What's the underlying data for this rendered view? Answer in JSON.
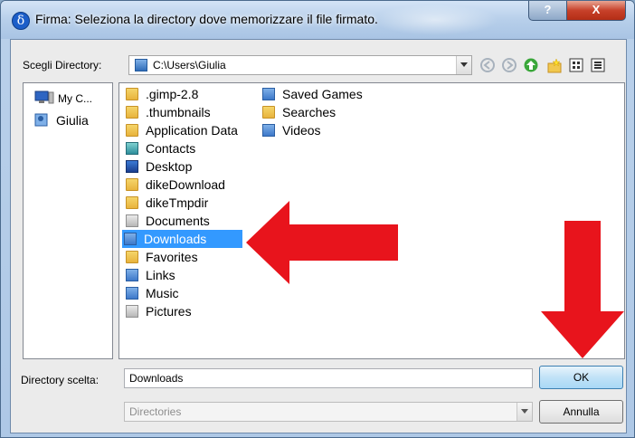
{
  "window": {
    "title": "Firma: Seleziona la directory dove memorizzare il file firmato.",
    "help_label": "?",
    "close_label": "X"
  },
  "toolbar": {
    "scegli_label": "Scegli Directory:",
    "path_value": "C:\\Users\\Giulia",
    "icons": [
      "back-icon",
      "forward-icon",
      "up-icon",
      "new-folder-icon",
      "grid-view-icon",
      "details-view-icon"
    ]
  },
  "sidebar": {
    "items": [
      {
        "label": "My C...",
        "icon": "computer-icon"
      },
      {
        "label": "Giulia",
        "icon": "user-folder-icon"
      }
    ]
  },
  "files": {
    "column1": [
      {
        "name": ".gimp-2.8",
        "icon": "folder"
      },
      {
        "name": ".thumbnails",
        "icon": "folder"
      },
      {
        "name": "Application Data",
        "icon": "folder"
      },
      {
        "name": "Contacts",
        "icon": "contacts-folder"
      },
      {
        "name": "Desktop",
        "icon": "desktop-folder"
      },
      {
        "name": "dikeDownload",
        "icon": "folder"
      },
      {
        "name": "dikeTmpdir",
        "icon": "folder"
      },
      {
        "name": "Documents",
        "icon": "documents-folder"
      },
      {
        "name": "Downloads",
        "icon": "downloads-folder",
        "selected": true
      },
      {
        "name": "Favorites",
        "icon": "favorites-folder"
      },
      {
        "name": "Links",
        "icon": "links-folder"
      },
      {
        "name": "Music",
        "icon": "music-folder"
      },
      {
        "name": "Pictures",
        "icon": "pictures-folder"
      }
    ],
    "column2": [
      {
        "name": "Saved Games",
        "icon": "saved-games-folder"
      },
      {
        "name": "Searches",
        "icon": "searches-folder"
      },
      {
        "name": "Videos",
        "icon": "videos-folder"
      }
    ]
  },
  "bottom": {
    "dir_label": "Directory scelta:",
    "dir_value": "Downloads",
    "filter_value": "Directories",
    "ok_label": "OK",
    "cancel_label": "Annulla"
  },
  "colors": {
    "selection": "#3399ff",
    "arrow": "#e8141c"
  }
}
